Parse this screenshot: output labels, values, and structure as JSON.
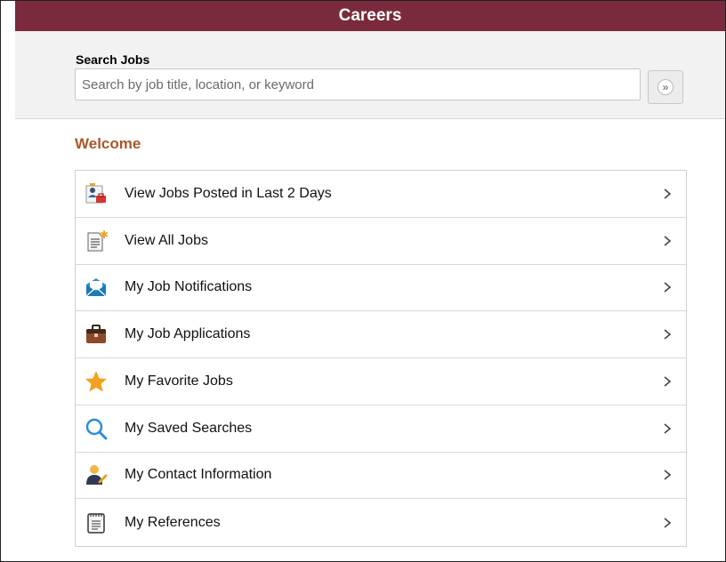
{
  "header": {
    "title": "Careers"
  },
  "search": {
    "label": "Search Jobs",
    "placeholder": "Search by job title, location, or keyword",
    "value": "",
    "button_icon": "double-chevron-right-icon"
  },
  "welcome": {
    "title": "Welcome"
  },
  "menu": {
    "items": [
      {
        "label": "View Jobs Posted in Last 2 Days",
        "icon": "recent-jobs-icon"
      },
      {
        "label": "View All Jobs",
        "icon": "new-document-icon"
      },
      {
        "label": "My Job Notifications",
        "icon": "envelope-icon"
      },
      {
        "label": "My Job Applications",
        "icon": "briefcase-icon"
      },
      {
        "label": "My Favorite Jobs",
        "icon": "star-icon"
      },
      {
        "label": "My Saved Searches",
        "icon": "magnifier-icon"
      },
      {
        "label": "My Contact Information",
        "icon": "contact-person-icon"
      },
      {
        "label": "My References",
        "icon": "notepad-icon"
      }
    ]
  },
  "colors": {
    "header_bg": "#7a2a3c",
    "welcome_text": "#a9562a",
    "star": "#f2a01f",
    "magnifier": "#2b8fd6",
    "envelope": "#2e8fd1"
  }
}
